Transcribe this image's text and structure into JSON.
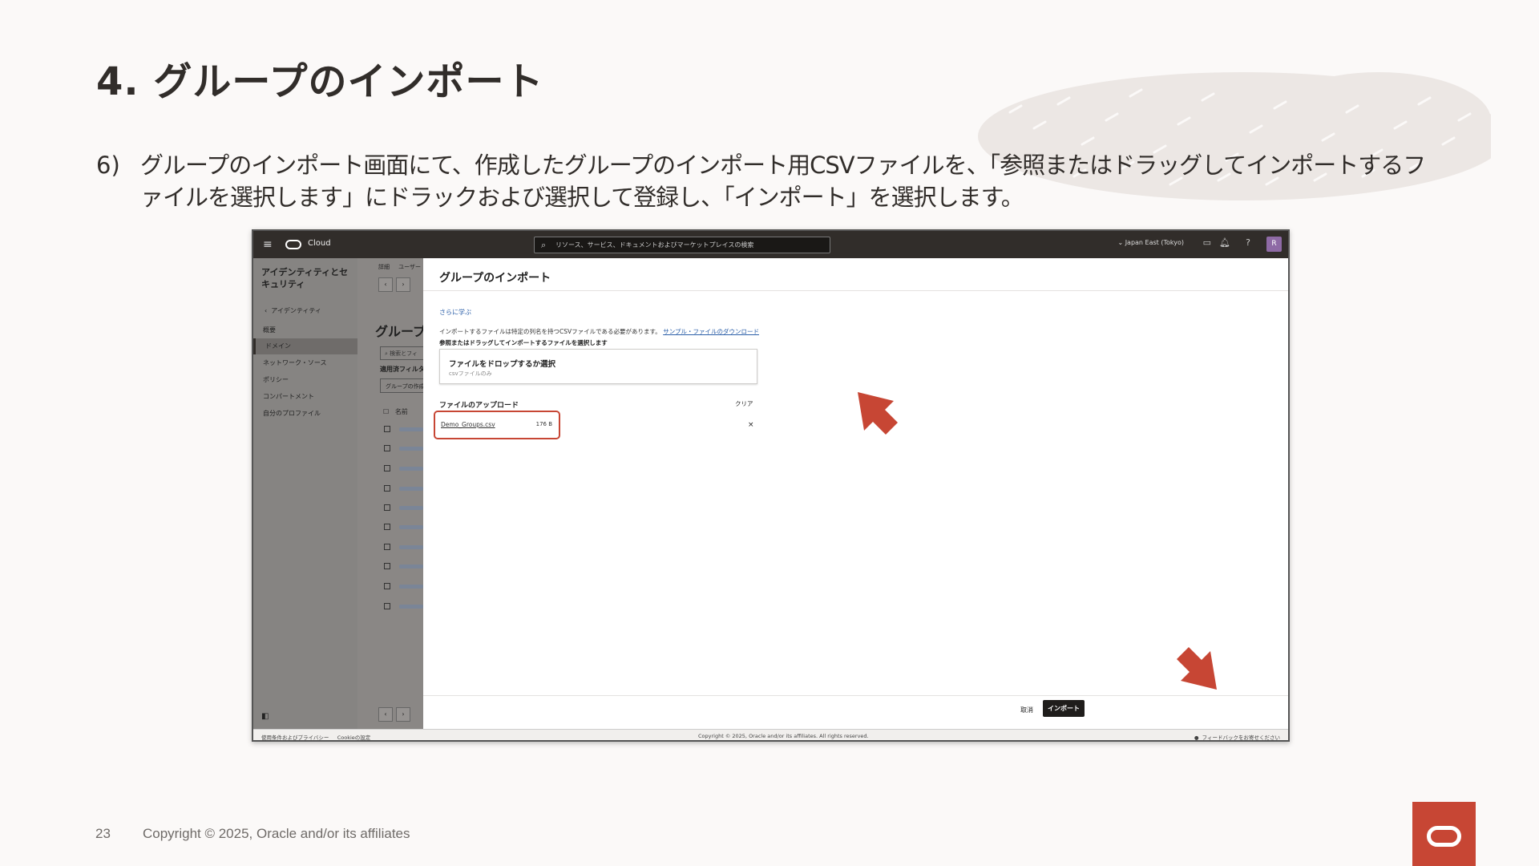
{
  "slide": {
    "title": "4. グループのインポート",
    "step_number": "6)",
    "instruction": "グループのインポート画面にて、作成したグループのインポート用CSVファイルを、「参照またはドラッグしてインポートするファイルを選択します」にドラックおよび選択して登録し、「インポート」を選択します。",
    "page_number": "23",
    "copyright": "Copyright © 2025, Oracle and/or its affiliates"
  },
  "console": {
    "topbar": {
      "brand": "Cloud",
      "search_placeholder": "リソース、サービス、ドキュメントおよびマーケットプレイスの検索",
      "region": "Japan East (Tokyo)",
      "avatar_initial": "R"
    },
    "sidebar": {
      "heading": "アイデンティティとセキュリティ",
      "back_label": "アイデンティティ",
      "items": [
        {
          "label": "概要"
        },
        {
          "label": "ドメイン"
        },
        {
          "label": "ネットワーク・ソース"
        },
        {
          "label": "ポリシー"
        },
        {
          "label": "コンパートメント"
        },
        {
          "label": "自分のプロファイル"
        }
      ]
    },
    "midpane": {
      "tab_details": "詳細",
      "tab_users": "ユーザー",
      "title": "グループ",
      "search_placeholder": "検索とフィ",
      "filter_label": "適用済フィルタ",
      "create_button": "グループの作成",
      "column_name": "名前"
    },
    "panel": {
      "title": "グループのインポート",
      "learn_more": "さらに学ぶ",
      "description": "インポートするファイルは特定の列名を持つCSVファイルである必要があります。",
      "sample_link": "サンプル・ファイルのダウンロード",
      "drop_label": "参照またはドラッグしてインポートするファイルを選択します",
      "drop_main": "ファイルをドロップするか選択",
      "drop_sub": "csvファイルのみ",
      "upload_heading": "ファイルのアップロード",
      "clear": "クリア",
      "file_name": "Demo_Groups.csv",
      "file_size": "176 B",
      "cancel": "取消",
      "import": "インポート"
    },
    "bottombar": {
      "terms": "使用条件およびプライバシー",
      "cookies": "Cookieの設定",
      "copyright": "Copyright © 2025, Oracle and/or its affiliates. All rights reserved.",
      "feedback": "フィードバックをお寄せください"
    }
  },
  "colors": {
    "accent_red": "#c74634",
    "topbar": "#312d2a",
    "link": "#2a5ea8"
  }
}
